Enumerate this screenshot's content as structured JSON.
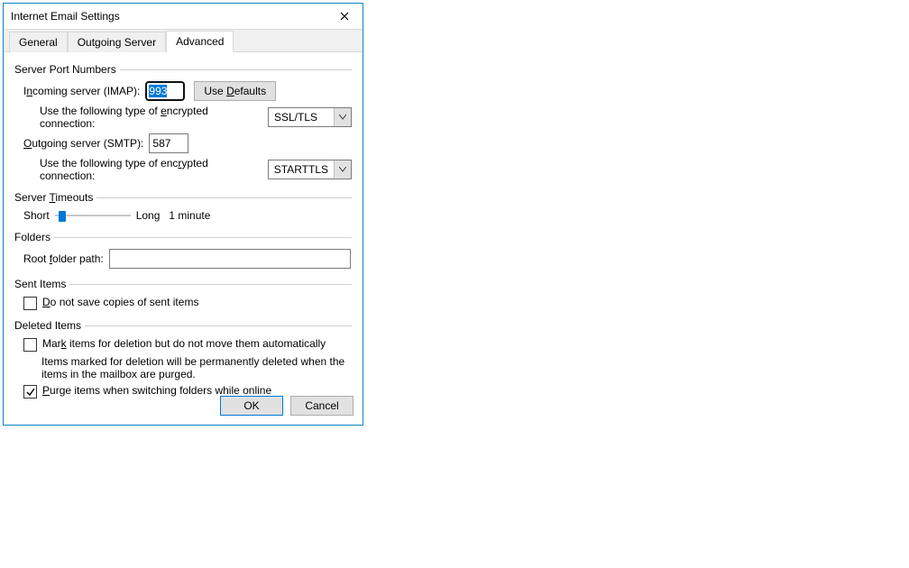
{
  "dialog": {
    "title": "Internet Email Settings"
  },
  "tabs": {
    "general": "General",
    "outgoing": "Outgoing Server",
    "advanced": "Advanced"
  },
  "groups": {
    "serverports": "Server Port Numbers",
    "timeouts": "Server Timeouts",
    "folders": "Folders",
    "sent": "Sent Items",
    "deleted": "Deleted Items"
  },
  "serverports": {
    "incoming_label_pre": "I",
    "incoming_label_u": "n",
    "incoming_label_post": "coming server (IMAP):",
    "incoming_value": "993",
    "usedefaults_pre": "Use ",
    "usedefaults_u": "D",
    "usedefaults_post": "efaults",
    "enc_label_pre": "Use the following type of ",
    "enc_label_u": "e",
    "enc_label_post": "ncrypted connection:",
    "incoming_enc": "SSL/TLS",
    "outgoing_label_pre": "O",
    "outgoing_label_u": "u",
    "outgoing_label_post": "tgoing server (SMTP):",
    "outgoing_value": "587",
    "enc2_label_pre": "Use the following type of enc",
    "enc2_label_u": "r",
    "enc2_label_post": "ypted connection:",
    "outgoing_enc": "STARTTLS"
  },
  "timeouts": {
    "short": "Short",
    "long": "Long",
    "value": "1 minute"
  },
  "folders": {
    "root_pre": "Root ",
    "root_u": "f",
    "root_post": "older path:",
    "root_value": ""
  },
  "sent": {
    "nosave_pre": "D",
    "nosave_u": "o",
    "nosave_post": " not save copies of sent items"
  },
  "deleted": {
    "mark_pre": "Mar",
    "mark_u": "k",
    "mark_post": " items for deletion but do not move them automatically",
    "mark_note": "Items marked for deletion will be permanently deleted when the items in the mailbox are purged.",
    "purge_pre": "P",
    "purge_u": "u",
    "purge_post": "rge items when switching folders while online"
  },
  "buttons": {
    "ok": "OK",
    "cancel": "Cancel"
  }
}
